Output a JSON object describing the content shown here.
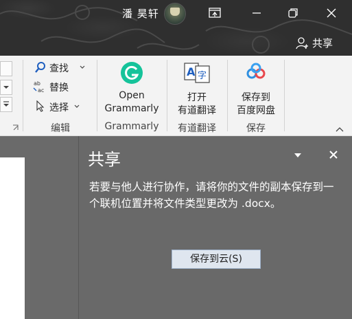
{
  "titlebar": {
    "user_name": "潘 昊轩",
    "share_label": "共享"
  },
  "ribbon": {
    "editing": {
      "find_label": "查找",
      "replace_label": "替换",
      "select_label": "选择",
      "group_label": "编辑"
    },
    "grammarly": {
      "button_line1": "Open",
      "button_line2": "Grammarly",
      "group_label": "Grammarly"
    },
    "youdao": {
      "button_line1": "打开",
      "button_line2": "有道翻译",
      "group_label": "有道翻译"
    },
    "save": {
      "button_line1": "保存到",
      "button_line2": "百度网盘",
      "group_label": "保存"
    }
  },
  "share_pane": {
    "title": "共享",
    "message": "若要与他人进行协作，请将你的文件的副本保存到一个联机位置并将文件类型更改为 .docx。",
    "save_to_cloud_label": "保存到云(S)"
  },
  "colors": {
    "titlebar_bg": "#2f2f2f",
    "ribbon_bg": "#f3f3f3",
    "pane_bg": "#696969",
    "grammarly_green": "#15c39a",
    "baidu_blue": "#2f8fe0"
  }
}
